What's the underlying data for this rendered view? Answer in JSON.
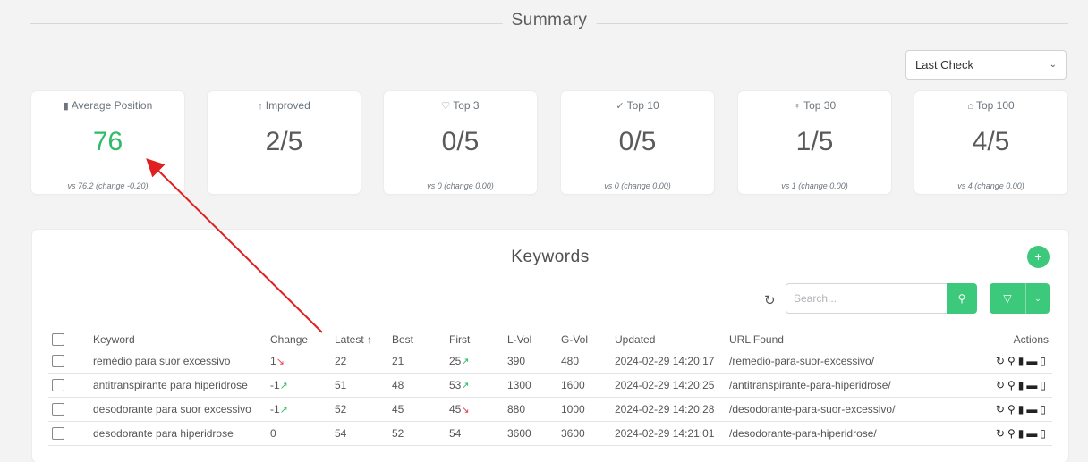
{
  "summary": {
    "title": "Summary",
    "period_select": {
      "value": "Last Check"
    }
  },
  "cards": [
    {
      "icon": "bar-chart-icon",
      "glyph": "▮",
      "label": "Average Position",
      "value": "76",
      "sub": "vs 76.2 (change -0.20)",
      "good": true
    },
    {
      "icon": "arrow-up-icon",
      "glyph": "↑",
      "label": "Improved",
      "value": "2/5",
      "sub": "",
      "good": false
    },
    {
      "icon": "heart-icon",
      "glyph": "♡",
      "label": "Top 3",
      "value": "0/5",
      "sub": "vs 0 (change 0.00)",
      "good": false
    },
    {
      "icon": "check-icon",
      "glyph": "✓",
      "label": "Top 10",
      "value": "0/5",
      "sub": "vs 0 (change 0.00)",
      "good": false
    },
    {
      "icon": "award-icon",
      "glyph": "♀",
      "label": "Top 30",
      "value": "1/5",
      "sub": "vs 1 (change 0.00)",
      "good": false
    },
    {
      "icon": "gift-icon",
      "glyph": "⌂",
      "label": "Top 100",
      "value": "4/5",
      "sub": "vs 4 (change 0.00)",
      "good": false
    }
  ],
  "keywords": {
    "title": "Keywords",
    "add_label": "+",
    "search_placeholder": "Search...",
    "columns": [
      "Keyword",
      "Change",
      "Latest ↑",
      "Best",
      "First",
      "L-Vol",
      "G-Vol",
      "Updated",
      "URL Found",
      "Actions"
    ],
    "rows": [
      {
        "keyword": "remédio para suor excessivo",
        "change": "1",
        "change_dir": "down",
        "latest": "22",
        "best": "21",
        "first": "25",
        "first_dir": "up",
        "lvol": "390",
        "gvol": "480",
        "updated": "2024-02-29 14:20:17",
        "url": "/remedio-para-suor-excessivo/"
      },
      {
        "keyword": "antitranspirante para hiperidrose",
        "change": "-1",
        "change_dir": "up",
        "latest": "51",
        "best": "48",
        "first": "53",
        "first_dir": "up",
        "lvol": "1300",
        "gvol": "1600",
        "updated": "2024-02-29 14:20:25",
        "url": "/antitranspirante-para-hiperidrose/"
      },
      {
        "keyword": "desodorante para suor excessivo",
        "change": "-1",
        "change_dir": "up",
        "latest": "52",
        "best": "45",
        "first": "45",
        "first_dir": "down",
        "lvol": "880",
        "gvol": "1000",
        "updated": "2024-02-29 14:20:28",
        "url": "/desodorante-para-suor-excessivo/"
      },
      {
        "keyword": "desodorante para hiperidrose",
        "change": "0",
        "change_dir": "",
        "latest": "54",
        "best": "52",
        "first": "54",
        "first_dir": "",
        "lvol": "3600",
        "gvol": "3600",
        "updated": "2024-02-29 14:21:01",
        "url": "/desodorante-para-hiperidrose/"
      }
    ]
  },
  "colors": {
    "accent": "#3cc97b",
    "annotation_arrow": "#e02020"
  }
}
